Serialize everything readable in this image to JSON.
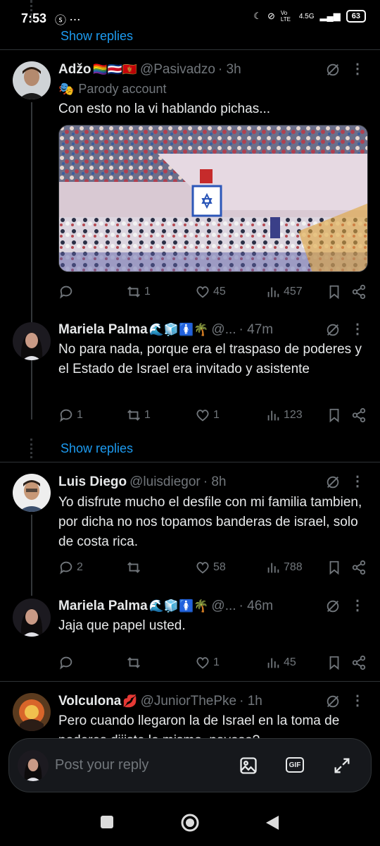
{
  "status_bar": {
    "time": "7:53",
    "left_icons": "ⓢ ⋯",
    "network": "4.5G",
    "volte": "Vo LTE",
    "battery": "63"
  },
  "threads": {
    "show_replies_label": "Show replies"
  },
  "tweets": [
    {
      "name": "Adžo",
      "emojis": "🏳️‍🌈🇨🇷🇲🇪",
      "handle": "@Pasivadzo",
      "time": "· 3h",
      "parody_label": "Parody account",
      "text": "Con esto no la vi hablando pichas...",
      "replies": "",
      "reposts": "1",
      "likes": "45",
      "views": "457"
    },
    {
      "name": "Mariela Palma",
      "emojis": "🌊🧊🚺🌴",
      "handle": "@...",
      "time": "· 47m",
      "text": "No para nada, porque era el traspaso de poderes y el Estado de Israel era invitado y asistente",
      "replies": "1",
      "reposts": "1",
      "likes": "1",
      "views": "123"
    },
    {
      "name": "Luis Diego",
      "emojis": "",
      "handle": "@luisdiegor",
      "time": "· 8h",
      "text": "Yo disfrute mucho el desfile con mi familia tambien, por dicha no nos topamos banderas de israel, solo de costa rica.",
      "replies": "2",
      "reposts": "",
      "likes": "58",
      "views": "788"
    },
    {
      "name": "Mariela Palma",
      "emojis": "🌊🧊🚺🌴",
      "handle": "@...",
      "time": "· 46m",
      "text": "Jaja que papel usted.",
      "replies": "",
      "reposts": "",
      "likes": "1",
      "views": "45"
    },
    {
      "name": "Volculona",
      "emojis": "💋",
      "handle": "@JuniorThePke",
      "time": "· 1h",
      "text": "Pero cuando llegaron la de Israel en la toma de poderes dijiste lo mismo, pavoso?",
      "replies": "",
      "reposts": "",
      "likes": "",
      "views": ""
    }
  ],
  "reply_bar": {
    "placeholder": "Post your reply",
    "gif_label": "GIF"
  },
  "colors": {
    "accent": "#1d9bf0",
    "background": "#000000",
    "muted": "#71767b",
    "text": "#e7e9ea"
  }
}
